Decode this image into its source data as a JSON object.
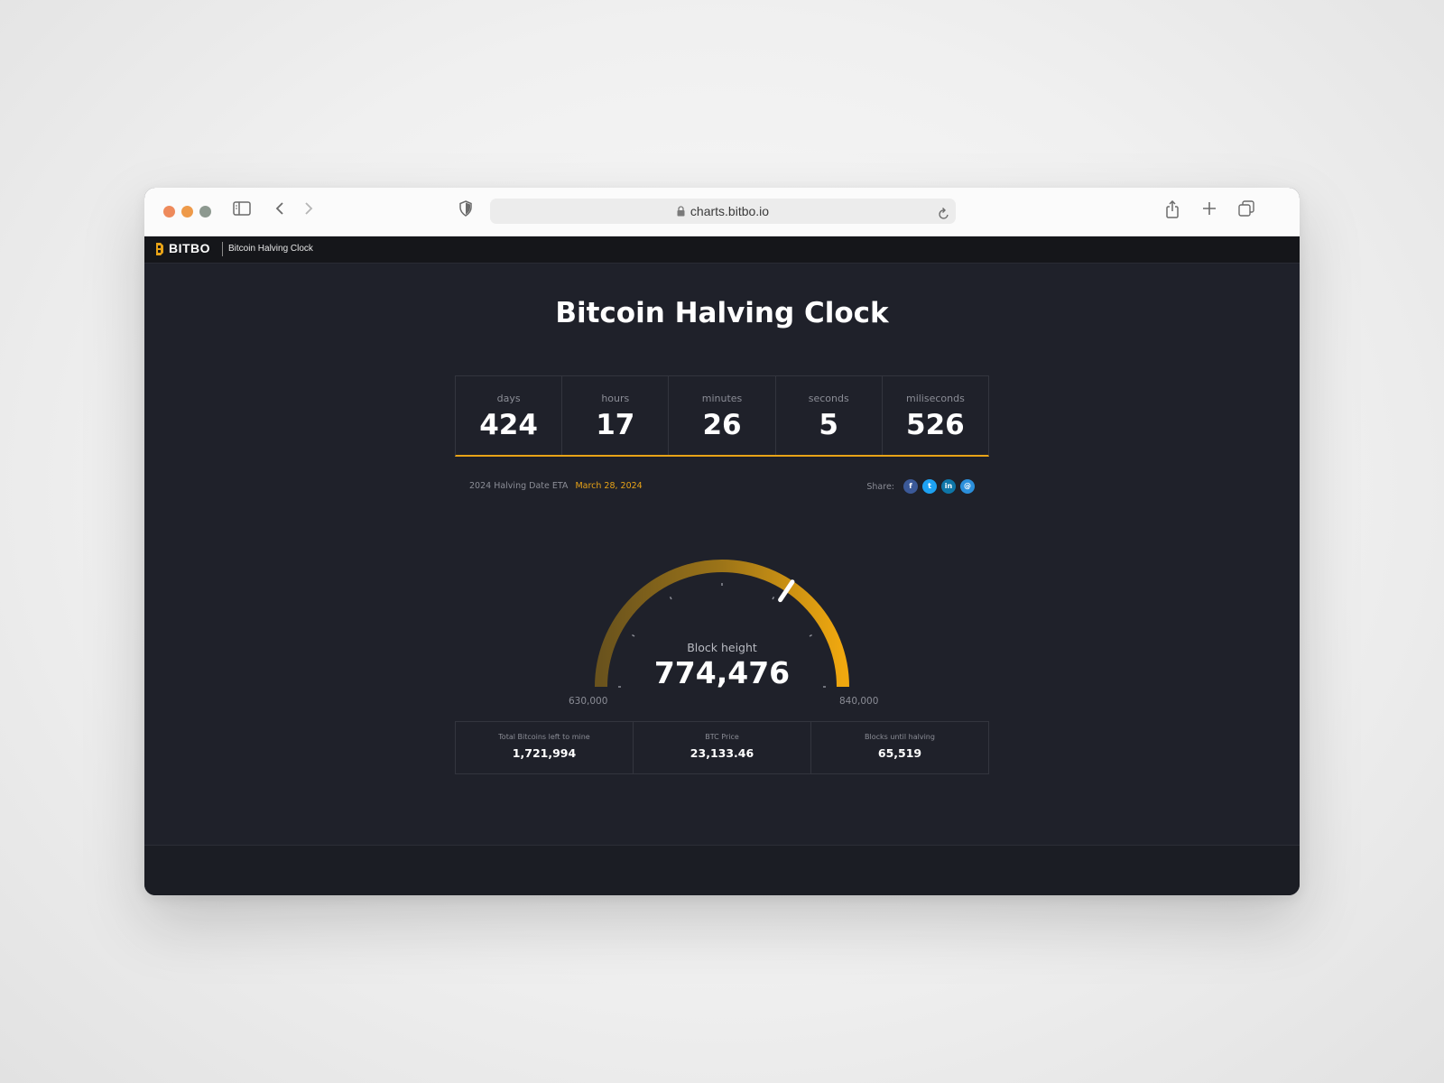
{
  "browser": {
    "url": "charts.bitbo.io"
  },
  "site": {
    "brand": "BITBO",
    "subtitle": "Bitcoin Halving Clock"
  },
  "page": {
    "title": "Bitcoin Halving Clock"
  },
  "countdown": [
    {
      "label": "days",
      "value": "424"
    },
    {
      "label": "hours",
      "value": "17"
    },
    {
      "label": "minutes",
      "value": "26"
    },
    {
      "label": "seconds",
      "value": "5"
    },
    {
      "label": "miliseconds",
      "value": "526"
    }
  ],
  "eta": {
    "label": "2024 Halving Date ETA",
    "date": "March 28, 2024"
  },
  "share": {
    "label": "Share:",
    "icons": [
      {
        "name": "facebook-icon",
        "glyph": "f",
        "color": "#3b5998"
      },
      {
        "name": "twitter-icon",
        "glyph": "t",
        "color": "#1da1f2"
      },
      {
        "name": "linkedin-icon",
        "glyph": "in",
        "color": "#0e76a8"
      },
      {
        "name": "email-icon",
        "glyph": "@",
        "color": "#2b8fdb"
      }
    ]
  },
  "gauge": {
    "label": "Block height",
    "value": "774,476",
    "min_label": "630,000",
    "max_label": "840,000",
    "min": 630000,
    "max": 840000,
    "current": 774476,
    "accent": "#e8a317"
  },
  "stats": [
    {
      "label": "Total Bitcoins left to mine",
      "value": "1,721,994"
    },
    {
      "label": "BTC Price",
      "value": "23,133.46"
    },
    {
      "label": "Blocks until halving",
      "value": "65,519"
    }
  ]
}
